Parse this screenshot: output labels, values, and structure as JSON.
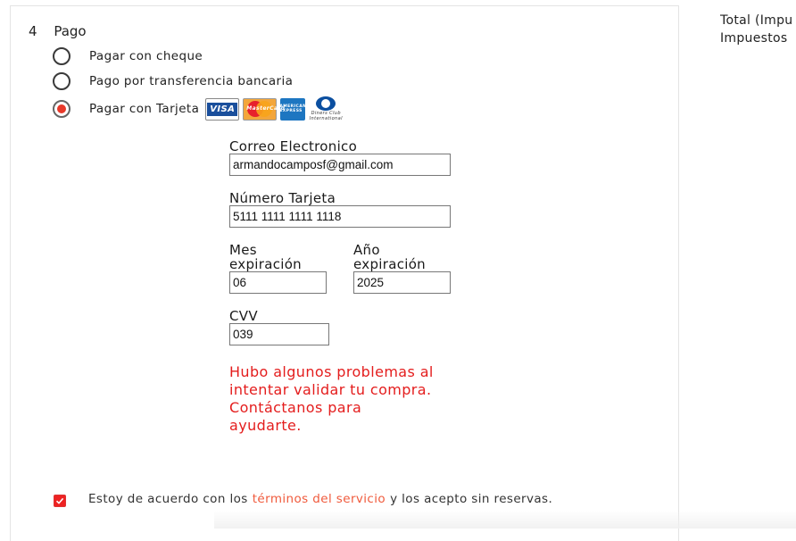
{
  "step": {
    "number": "4",
    "title": "Pago"
  },
  "payment_options": [
    {
      "label": "Pagar con cheque",
      "selected": false
    },
    {
      "label": "Pago por transferencia bancaria",
      "selected": false
    },
    {
      "label": "Pagar con Tarjeta",
      "selected": true
    }
  ],
  "card_logos": {
    "visa": "VISA",
    "mastercard": "MasterCard",
    "amex": "AMERICAN EXPRESS",
    "diners": "Diners Club International"
  },
  "form": {
    "email_label": "Correo Electronico",
    "email_value": "armandocamposf@gmail.com",
    "card_label": "Número Tarjeta",
    "card_value": "5111 1111 1111 1118",
    "month_label_1": "Mes",
    "month_label_2": "expiración",
    "month_value": "06",
    "year_label_1": "Año",
    "year_label_2": "expiración",
    "year_value": "2025",
    "cvv_label": "CVV",
    "cvv_value": "039"
  },
  "error": {
    "line1": "Hubo algunos problemas al",
    "line2": "intentar validar tu compra.",
    "line3": "Contáctanos para",
    "line4": "ayudarte.",
    "color": "#e41d1d"
  },
  "terms": {
    "checked": true,
    "prefix": "Estoy de acuerdo con los",
    "link": "términos del servicio",
    "suffix": "y los acepto sin reservas."
  },
  "summary": {
    "total_label": "Total (Impu",
    "taxes_label": "Impuestos"
  },
  "colors": {
    "accent": "#e8392a",
    "link": "#f05a3c"
  }
}
